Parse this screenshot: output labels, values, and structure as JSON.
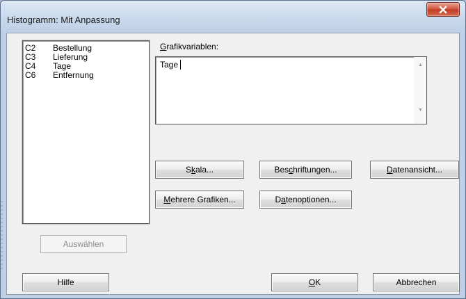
{
  "window": {
    "title": "Histogramm: Mit Anpassung"
  },
  "variables_list": [
    {
      "col": "C2",
      "name": "Bestellung"
    },
    {
      "col": "C3",
      "name": "Lieferung"
    },
    {
      "col": "C4",
      "name": "Tage"
    },
    {
      "col": "C6",
      "name": "Entfernung"
    }
  ],
  "graph_variables": {
    "label_prefix": "",
    "label_key": "G",
    "label_rest": "rafikvariablen:",
    "value": "Tage"
  },
  "buttons": {
    "skala": {
      "pre": "S",
      "key": "k",
      "post": "ala..."
    },
    "beschriftungen": {
      "pre": "Bes",
      "key": "c",
      "post": "hriftungen..."
    },
    "datenansicht": {
      "pre": "",
      "key": "D",
      "post": "atenansicht..."
    },
    "mehrere_grafiken": {
      "pre": "",
      "key": "M",
      "post": "ehrere Grafiken..."
    },
    "datenoptionen": {
      "pre": "D",
      "key": "a",
      "post": "tenoptionen..."
    },
    "auswaehlen": "Auswählen",
    "hilfe": "Hilfe",
    "ok": {
      "pre": "",
      "key": "O",
      "post": "K"
    },
    "abbrechen": "Abbrechen"
  },
  "colors": {
    "close_button": "#c9432b",
    "dialog_background": "#f0f0f0",
    "title_bar": "#c9d9ec"
  }
}
